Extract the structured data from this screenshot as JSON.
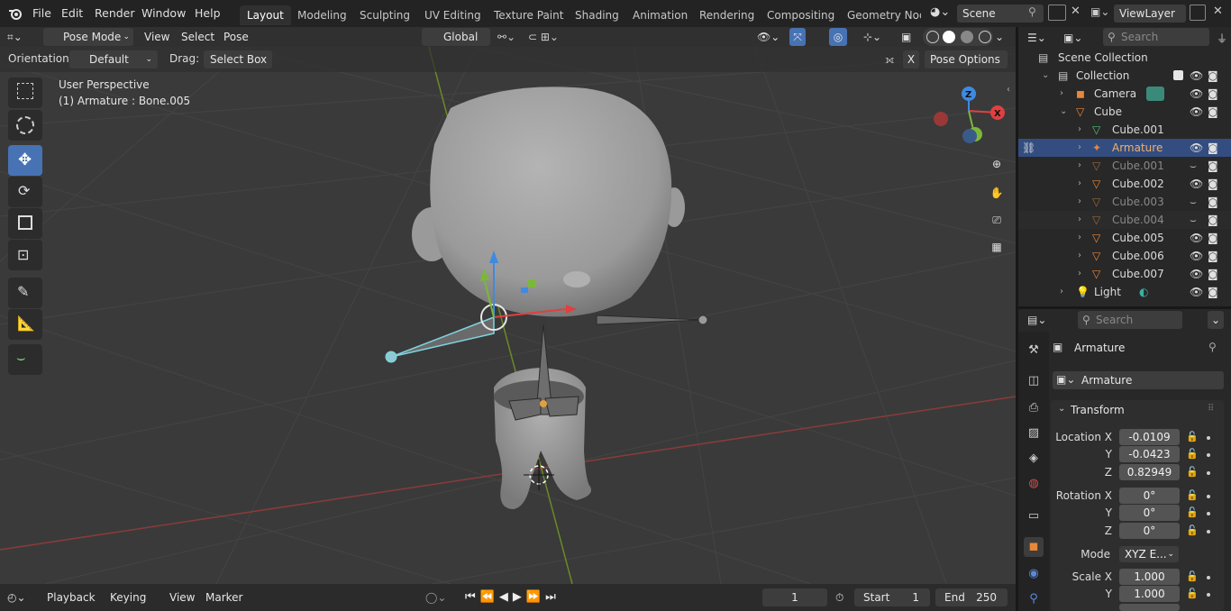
{
  "topbar": {
    "menus": [
      "File",
      "Edit",
      "Render",
      "Window",
      "Help"
    ],
    "workspaces": [
      "Layout",
      "Modeling",
      "Sculpting",
      "UV Editing",
      "Texture Paint",
      "Shading",
      "Animation",
      "Rendering",
      "Compositing",
      "Geometry Node"
    ],
    "active_workspace": "Layout",
    "scene": "Scene",
    "view_layer": "ViewLayer"
  },
  "viewport_header": {
    "mode": "Pose Mode",
    "menus": [
      "View",
      "Select",
      "Pose"
    ],
    "transform_orientation": "Global"
  },
  "tool_settings": {
    "orientation_label": "Orientation:",
    "orientation_value": "Default",
    "drag_label": "Drag:",
    "drag_value": "Select Box",
    "x_label": "X",
    "pose_options": "Pose Options"
  },
  "viewport": {
    "perspective_text": "User Perspective",
    "object_text": "(1) Armature : Bone.005",
    "gizmo_axes": {
      "x": "X",
      "y": "Y",
      "z": "Z"
    }
  },
  "timeline": {
    "menus": [
      "Playback",
      "Keying",
      "View",
      "Marker"
    ],
    "current_frame": "1",
    "start_label": "Start",
    "start_value": "1",
    "end_label": "End",
    "end_value": "250"
  },
  "outliner": {
    "search_placeholder": "Search",
    "scene_collection": "Scene Collection",
    "rows": [
      {
        "label": "Collection"
      },
      {
        "label": "Camera"
      },
      {
        "label": "Cube"
      },
      {
        "label": "Cube.001"
      },
      {
        "label": "Armature"
      },
      {
        "label": "Cube.001"
      },
      {
        "label": "Cube.002"
      },
      {
        "label": "Cube.003"
      },
      {
        "label": "Cube.004"
      },
      {
        "label": "Cube.005"
      },
      {
        "label": "Cube.006"
      },
      {
        "label": "Cube.007"
      },
      {
        "label": "Light"
      }
    ]
  },
  "properties": {
    "search_placeholder": "Search",
    "object_name": "Armature",
    "datablock_name": "Armature",
    "panel_title": "Transform",
    "location_label": "Location X",
    "location": {
      "x": "-0.0109",
      "y": "-0.0423",
      "z": "0.82949"
    },
    "rotation_label": "Rotation X",
    "rotation": {
      "x": "0°",
      "y": "0°",
      "z": "0°"
    },
    "mode_label": "Mode",
    "mode_value": "XYZ E...",
    "scale_label": "Scale X",
    "scale": {
      "x": "1.000",
      "y": "1.000"
    },
    "axis_y": "Y",
    "axis_z": "Z"
  },
  "colors": {
    "accent": "#4772b3",
    "selection_row": "#334d80",
    "orange_icon": "#e8873a",
    "bone_selected": "#7fd4e0"
  }
}
